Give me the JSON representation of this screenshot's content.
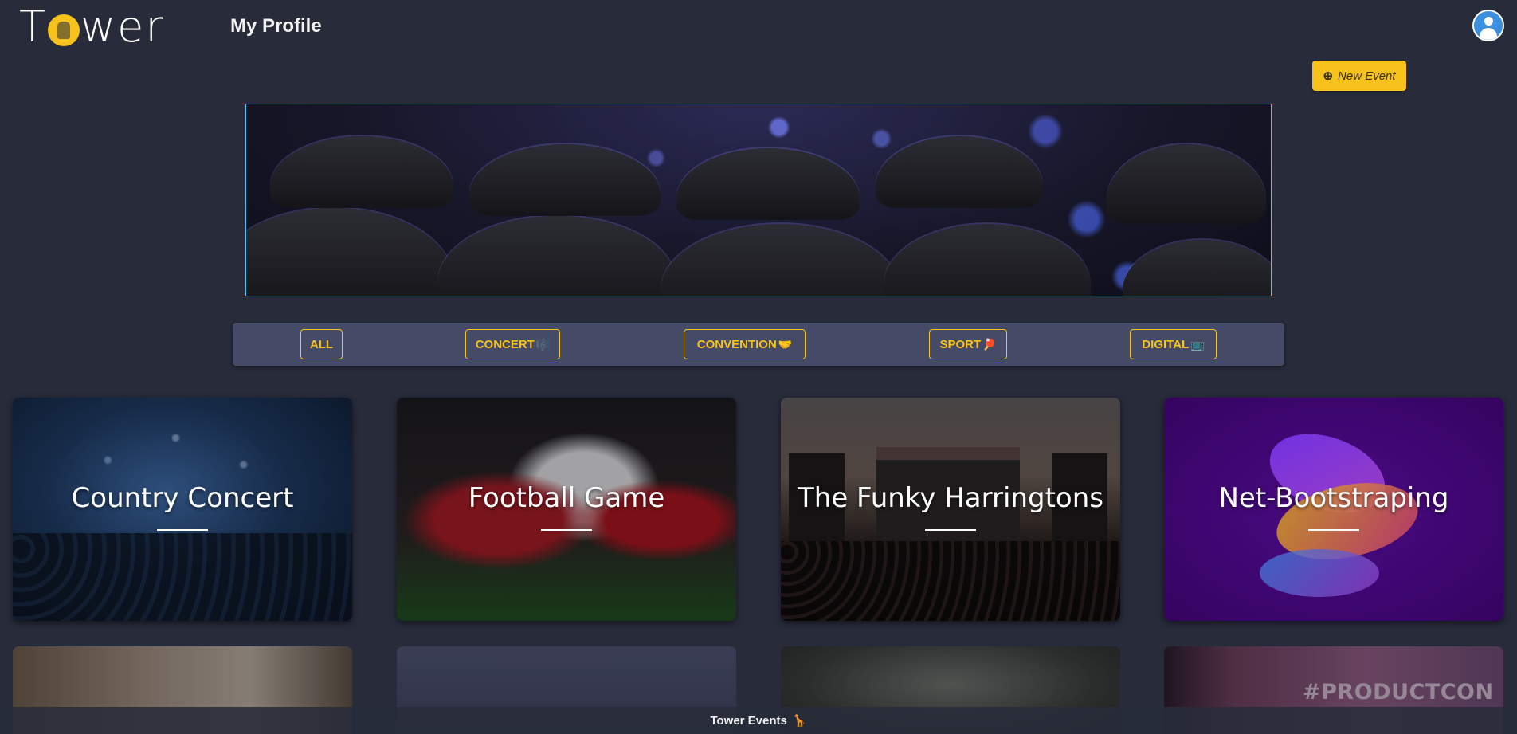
{
  "navbar": {
    "logo_text_start": "T",
    "logo_text_end": "wer",
    "title": "My Profile"
  },
  "actions": {
    "new_event_icon": "⊕",
    "new_event_label": "New Event"
  },
  "filters": [
    {
      "label": "ALL",
      "emoji": ""
    },
    {
      "label": "CONCERT",
      "emoji": "🎼"
    },
    {
      "label": "CONVENTION",
      "emoji": "🤝"
    },
    {
      "label": "SPORT",
      "emoji": "🏓"
    },
    {
      "label": "DIGITAL",
      "emoji": "📺"
    }
  ],
  "events": [
    {
      "name": "Country Concert"
    },
    {
      "name": "Football Game"
    },
    {
      "name": "The Funky Harringtons"
    },
    {
      "name": "Net-Bootstraping"
    }
  ],
  "events_row2": [
    {
      "overlay_text": ""
    },
    {
      "overlay_text": ""
    },
    {
      "overlay_text": ""
    },
    {
      "overlay_text": "#PRODUCTCON"
    }
  ],
  "footer": {
    "text": "Tower Events",
    "icon": "🦒"
  },
  "colors": {
    "background": "#272b3a",
    "accent": "#f6c21b",
    "filter_bar": "#454b66",
    "banner_border": "#4dc3ff"
  },
  "icons": {
    "logo": "giraffe-in-circle-icon",
    "avatar": "user-avatar-icon",
    "new_event": "plus-icon",
    "footer": "giraffe-icon"
  }
}
